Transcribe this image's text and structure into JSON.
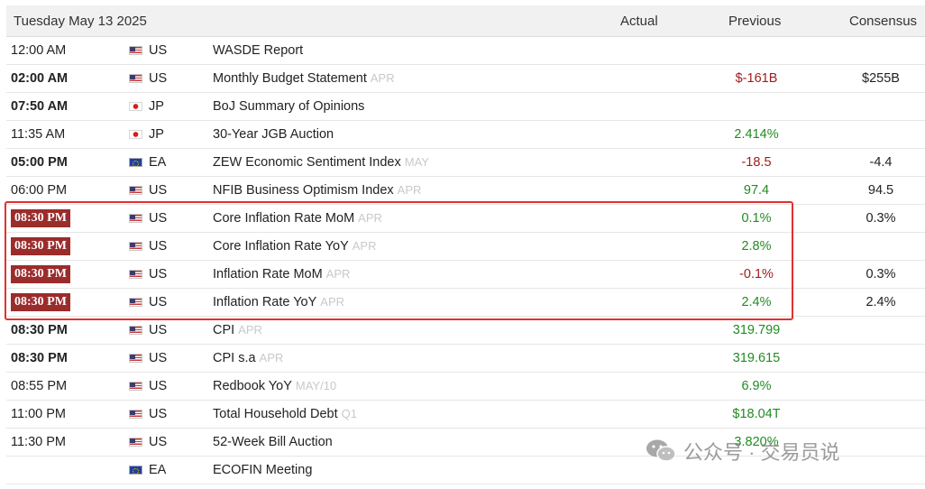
{
  "header": {
    "date": "Tuesday May 13 2025",
    "actual": "Actual",
    "previous": "Previous",
    "consensus": "Consensus"
  },
  "rows": [
    {
      "time": "12:00 AM",
      "bold": false,
      "badge": false,
      "flag": "us",
      "country": "US",
      "event": "WASDE Report",
      "period": "",
      "previous": "",
      "prev_color": "neu",
      "consensus": ""
    },
    {
      "time": "02:00 AM",
      "bold": true,
      "badge": false,
      "flag": "us",
      "country": "US",
      "event": "Monthly Budget Statement",
      "period": "APR",
      "previous": "$-161B",
      "prev_color": "neg",
      "consensus": "$255B"
    },
    {
      "time": "07:50 AM",
      "bold": true,
      "badge": false,
      "flag": "jp",
      "country": "JP",
      "event": "BoJ Summary of Opinions",
      "period": "",
      "previous": "",
      "prev_color": "neu",
      "consensus": ""
    },
    {
      "time": "11:35 AM",
      "bold": false,
      "badge": false,
      "flag": "jp",
      "country": "JP",
      "event": "30-Year JGB Auction",
      "period": "",
      "previous": "2.414%",
      "prev_color": "pos",
      "consensus": ""
    },
    {
      "time": "05:00 PM",
      "bold": true,
      "badge": false,
      "flag": "eu",
      "country": "EA",
      "event": "ZEW Economic Sentiment Index",
      "period": "MAY",
      "previous": "-18.5",
      "prev_color": "neg",
      "consensus": "-4.4"
    },
    {
      "time": "06:00 PM",
      "bold": false,
      "badge": false,
      "flag": "us",
      "country": "US",
      "event": "NFIB Business Optimism Index",
      "period": "APR",
      "previous": "97.4",
      "prev_color": "pos",
      "consensus": "94.5"
    },
    {
      "time": "08:30 PM",
      "bold": true,
      "badge": true,
      "flag": "us",
      "country": "US",
      "event": "Core Inflation Rate MoM",
      "period": "APR",
      "previous": "0.1%",
      "prev_color": "pos",
      "consensus": "0.3%"
    },
    {
      "time": "08:30 PM",
      "bold": true,
      "badge": true,
      "flag": "us",
      "country": "US",
      "event": "Core Inflation Rate YoY",
      "period": "APR",
      "previous": "2.8%",
      "prev_color": "pos",
      "consensus": ""
    },
    {
      "time": "08:30 PM",
      "bold": true,
      "badge": true,
      "flag": "us",
      "country": "US",
      "event": "Inflation Rate MoM",
      "period": "APR",
      "previous": "-0.1%",
      "prev_color": "neg",
      "consensus": "0.3%"
    },
    {
      "time": "08:30 PM",
      "bold": true,
      "badge": true,
      "flag": "us",
      "country": "US",
      "event": "Inflation Rate YoY",
      "period": "APR",
      "previous": "2.4%",
      "prev_color": "pos",
      "consensus": "2.4%"
    },
    {
      "time": "08:30 PM",
      "bold": true,
      "badge": false,
      "flag": "us",
      "country": "US",
      "event": "CPI",
      "period": "APR",
      "previous": "319.799",
      "prev_color": "pos",
      "consensus": ""
    },
    {
      "time": "08:30 PM",
      "bold": true,
      "badge": false,
      "flag": "us",
      "country": "US",
      "event": "CPI s.a",
      "period": "APR",
      "previous": "319.615",
      "prev_color": "pos",
      "consensus": ""
    },
    {
      "time": "08:55 PM",
      "bold": false,
      "badge": false,
      "flag": "us",
      "country": "US",
      "event": "Redbook YoY",
      "period": "MAY/10",
      "previous": "6.9%",
      "prev_color": "pos",
      "consensus": ""
    },
    {
      "time": "11:00 PM",
      "bold": false,
      "badge": false,
      "flag": "us",
      "country": "US",
      "event": "Total Household Debt",
      "period": "Q1",
      "previous": "$18.04T",
      "prev_color": "pos",
      "consensus": ""
    },
    {
      "time": "11:30 PM",
      "bold": false,
      "badge": false,
      "flag": "us",
      "country": "US",
      "event": "52-Week Bill Auction",
      "period": "",
      "previous": "3.820%",
      "prev_color": "pos",
      "consensus": ""
    },
    {
      "time": "",
      "bold": false,
      "badge": false,
      "flag": "eu",
      "country": "EA",
      "event": "ECOFIN Meeting",
      "period": "",
      "previous": "",
      "prev_color": "neu",
      "consensus": ""
    }
  ],
  "watermark": {
    "text": "公众号 · 交易员说",
    "icon": "wechat-icon"
  },
  "colors": {
    "positive": "#228b22",
    "negative": "#a11d1d",
    "badge": "#9b2c2c",
    "highlight": "#e03131"
  }
}
